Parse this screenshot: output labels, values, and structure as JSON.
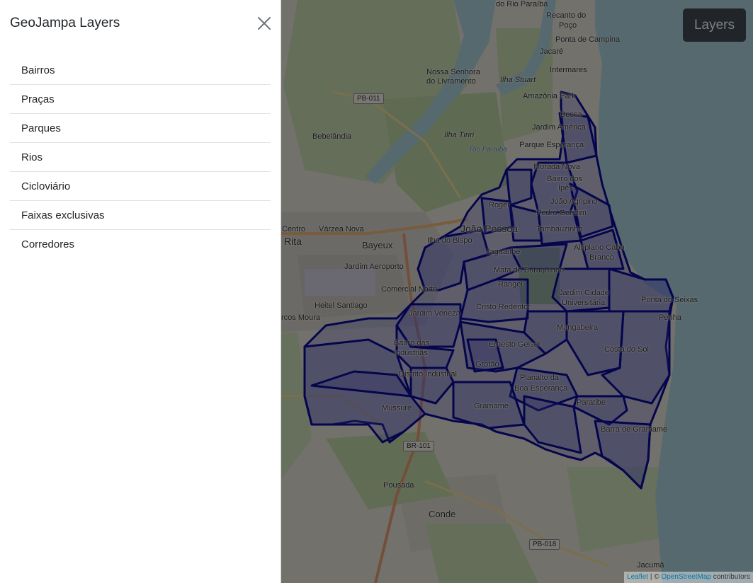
{
  "panel": {
    "title": "GeoJampa Layers",
    "layers": [
      {
        "label": "Bairros"
      },
      {
        "label": "Praças"
      },
      {
        "label": "Parques"
      },
      {
        "label": "Rios"
      },
      {
        "label": "Cicloviário"
      },
      {
        "label": "Faixas exclusivas"
      },
      {
        "label": "Corredores"
      }
    ]
  },
  "map": {
    "layers_button": "Layers",
    "attribution": {
      "leaflet": "Leaflet",
      "separator": " | © ",
      "osm": "OpenStreetMap",
      "suffix": " contributors"
    },
    "road_labels": [
      "PB-011",
      "BR-101",
      "PB-018"
    ],
    "places": {
      "do_rio_paraiba": "do Rio Paraíba",
      "recanto_do_poco": "Recanto do",
      "poco": "Poço",
      "ponta_de_campina": "Ponta de Campina",
      "jacare": "Jacaré",
      "nossa_senhora": "Nossa Senhora",
      "do_livramento": "do Livramento",
      "ilha_stuart": "Ilha Stuart",
      "intermares": "Intermares",
      "amazonia_park": "Amazônia Park",
      "bessa": "Bessa",
      "bebelandia": "Bebelândia",
      "ilha_tiriri": "Ilha Tiriri",
      "jardim_america": "Jardim América",
      "rio_paraiba": "Rio Paraíba",
      "parque_esperanca": "Parque Esperança",
      "morada_nova": "Morada Nova",
      "bairro_dos": "Bairro dos",
      "ipes": "Ipês",
      "roger": "Roger",
      "joao_agripino": "João Agripino",
      "pedro_gondim": "Pedro Gondim",
      "centro": "Centro",
      "varzea_nova": "Várzea Nova",
      "joao_pessoa": "João Pessoa",
      "tambauzinho": "Tambauzinho",
      "rita": "Rita",
      "bayeux": "Bayeux",
      "ilha_do_bispo": "Ilha do Bispo",
      "jaguaribe": "Jaguaribe",
      "altiplano_cabo": "Altiplano Cabo",
      "branco": "Branco",
      "jardim_aeroporto": "Jardim Aeroporto",
      "mata_do_buraquinho": "Mata do Buraquinho",
      "rangel": "Rangel",
      "comercial_norte": "Comercial Norte",
      "jardim_cidade": "Jardim Cidade",
      "universitaria": "Universitária",
      "ponta_do_seixas": "Ponta do Seixas",
      "heitel_santiago": "Heitel Santiago",
      "cristo_redentor": "Cristo Redentor",
      "cercos_moura": "rcos Moura",
      "jardim_veneza": "Jardim Veneza",
      "penha": "Penha",
      "mangabeira": "Mangabeira",
      "bairro_das": "Bairro das",
      "industrias": "Indústrias",
      "ernesto_geisel": "Ernesto Geisel",
      "costa_do_sol": "Costa do Sol",
      "grotao": "Grotão",
      "distrito_industrial": "Distrito Industrial",
      "planalto_da": "Planalto da",
      "boa_esperanca": "Boa Esperança",
      "gramame": "Gramame",
      "paratibe": "Paratibe",
      "mussure": "Mussuré",
      "barra_de_gramame": "Barra de Gramame",
      "pousada": "Pousada",
      "conde": "Conde",
      "jacuma": "Jacumã"
    }
  }
}
